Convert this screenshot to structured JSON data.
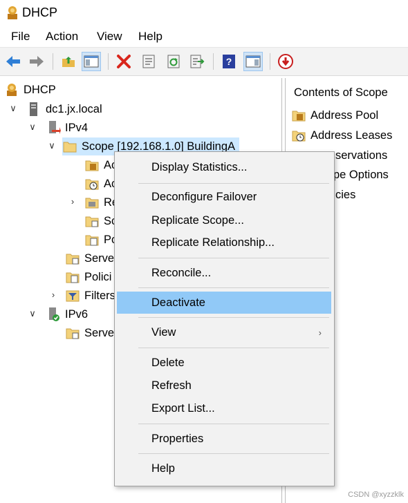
{
  "window": {
    "title": "DHCP"
  },
  "menu": [
    "File",
    "Action",
    "View",
    "Help"
  ],
  "toolbar": {
    "buttons": [
      "back-arrow-icon",
      "forward-arrow-icon",
      "up-folder-icon",
      "show-hide-console-tree-icon",
      "delete-icon",
      "properties-icon",
      "refresh-icon",
      "export-list-icon",
      "help-icon",
      "show-hide-action-pane-icon",
      "stop-icon"
    ]
  },
  "tree": {
    "root": "DHCP",
    "server": "dc1.jx.local",
    "ipv4": "IPv4",
    "scope": "Scope [192.168.1.0] BuildingA",
    "scope_children": [
      "Ac",
      "Ac",
      "Re",
      "Sc",
      "Po"
    ],
    "ipv4_children": [
      "Serve",
      "Polici",
      "Filters"
    ],
    "ipv6": "IPv6",
    "ipv6_children": [
      "Serve"
    ]
  },
  "right_pane": {
    "title": "Contents of Scope",
    "items": [
      "Address Pool",
      "Address Leases",
      "Reservations",
      "Scope Options",
      "Policies"
    ],
    "visible_text": [
      "Address Pool",
      "Address Leases",
      "servations",
      "pe Options",
      "cies"
    ]
  },
  "context_menu": {
    "items": [
      {
        "label": "Display Statistics..."
      },
      {
        "label": "Deconfigure Failover"
      },
      {
        "label": "Replicate Scope..."
      },
      {
        "label": "Replicate Relationship..."
      },
      {
        "label": "Reconcile..."
      },
      {
        "label": "Deactivate",
        "highlighted": true
      },
      {
        "label": "View",
        "submenu": true
      },
      {
        "label": "Delete"
      },
      {
        "label": "Refresh"
      },
      {
        "label": "Export List..."
      },
      {
        "label": "Properties"
      },
      {
        "label": "Help"
      }
    ]
  },
  "watermark": "CSDN @xyzzklk",
  "colors": {
    "selection": "#cce8ff",
    "menu_highlight": "#91c9f7",
    "menu_bg": "#f2f2f2"
  }
}
